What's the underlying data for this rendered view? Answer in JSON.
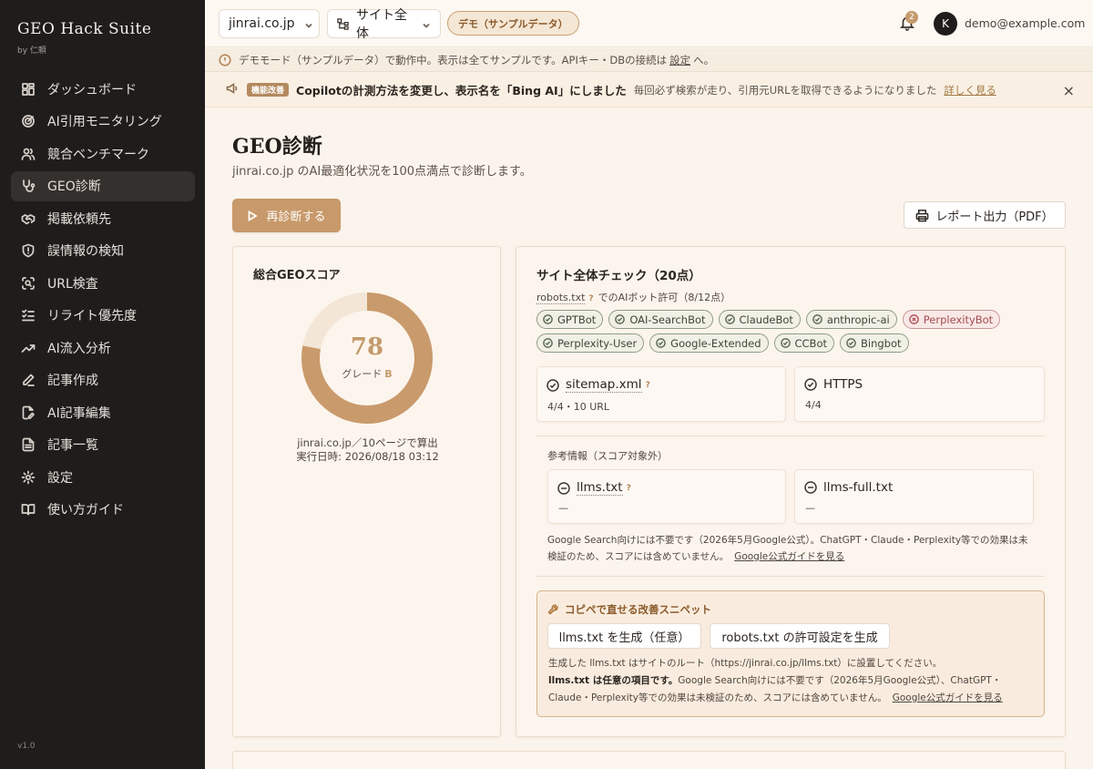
{
  "brand": {
    "name": "GEO Hack Suite",
    "by": "by 仁頼",
    "version": "v1.0"
  },
  "nav": [
    {
      "label": "ダッシュボード",
      "icon": "dashboard-icon"
    },
    {
      "label": "AI引用モニタリング",
      "icon": "radar-icon"
    },
    {
      "label": "競合ベンチマーク",
      "icon": "users-icon"
    },
    {
      "label": "GEO診断",
      "icon": "stethoscope-icon",
      "active": true
    },
    {
      "label": "掲載依頼先",
      "icon": "handshake-icon"
    },
    {
      "label": "誤情報の検知",
      "icon": "shield-alert-icon"
    },
    {
      "label": "URL検査",
      "icon": "scan-search-icon"
    },
    {
      "label": "リライト優先度",
      "icon": "list-checks-icon"
    },
    {
      "label": "AI流入分析",
      "icon": "trending-up-icon"
    },
    {
      "label": "記事作成",
      "icon": "pencil-icon"
    },
    {
      "label": "AI記事編集",
      "icon": "file-edit-icon"
    },
    {
      "label": "記事一覧",
      "icon": "file-text-icon"
    },
    {
      "label": "設定",
      "icon": "gear-icon"
    },
    {
      "label": "使い方ガイド",
      "icon": "book-icon"
    }
  ],
  "topbar": {
    "domain": "jinrai.co.jp",
    "scope": "サイト全体",
    "demo_badge": "デモ（サンプルデータ）",
    "notifications": "2",
    "avatar_initial": "K",
    "email": "demo@example.com"
  },
  "demo_bar": {
    "text": "デモモード（サンプルデータ）で動作中。表示は全てサンプルです。APIキー・DBの接続は",
    "link": "設定",
    "suffix": "へ。"
  },
  "notice": {
    "tag": "機能改善",
    "title": "Copilotの計測方法を変更し、表示名を「Bing AI」にしました",
    "desc": "毎回必ず検索が走り、引用元URLを取得できるようになりました",
    "link": "詳しく見る",
    "close": "×"
  },
  "page": {
    "title": "GEO診断",
    "subtitle": "jinrai.co.jp のAI最適化状況を100点満点で診断します。",
    "rerun": "再診断する",
    "export": "レポート出力（PDF）"
  },
  "score": {
    "title": "総合GEOスコア",
    "value": 78,
    "max": 100,
    "grade_label": "グレード",
    "grade": "B",
    "meta_line1": "jinrai.co.jp／10ページで算出",
    "meta_line2": "実行日時: 2026/08/18 03:12",
    "color": "#c99a6c",
    "track_color": "#f3e6d6"
  },
  "site_check": {
    "title": "サイト全体チェック（20点）",
    "robots_term": "robots.txt",
    "robots_help": "?",
    "robots_text": "でのAIボット許可（8/12点）",
    "bots_row1": [
      {
        "name": "GPTBot",
        "ok": true
      },
      {
        "name": "OAI-SearchBot",
        "ok": true
      },
      {
        "name": "ClaudeBot",
        "ok": true
      },
      {
        "name": "anthropic-ai",
        "ok": true
      },
      {
        "name": "PerplexityBot",
        "ok": false
      }
    ],
    "bots_row2": [
      {
        "name": "Perplexity-User",
        "ok": true
      },
      {
        "name": "Google-Extended",
        "ok": true
      },
      {
        "name": "CCBot",
        "ok": true
      },
      {
        "name": "Bingbot",
        "ok": true
      }
    ],
    "sitemap": {
      "label": "sitemap.xml",
      "help": "?",
      "value": "4/4・10 URL"
    },
    "https": {
      "label": "HTTPS",
      "value": "4/4"
    },
    "ref_label": "参考情報（スコア対象外）",
    "llms": {
      "label": "llms.txt",
      "help": "?",
      "value": "—"
    },
    "llms_full": {
      "label": "llms-full.txt",
      "value": "—"
    },
    "ref_note": "Google Search向けには不要です（2026年5月Google公式）。ChatGPT・Claude・Perplexity等での効果は未検証のため、スコアには含めていません。",
    "ref_link": "Google公式ガイドを見る"
  },
  "snippet": {
    "title": "コピペで直せる改善スニペット",
    "btn_llms": "llms.txt を生成（任意）",
    "btn_robots": "robots.txt の許可設定を生成",
    "note1": "生成した llms.txt はサイトのルート（https://jinrai.co.jp/llms.txt）に設置してください。",
    "note2_bold": "llms.txt は任意の項目です。",
    "note2": "Google Search向けには不要です（2026年5月Google公式）、ChatGPT・Claude・Perplexity等での効果は未検証のため、スコアには含めていません。",
    "link": "Google公式ガイドを見る"
  }
}
